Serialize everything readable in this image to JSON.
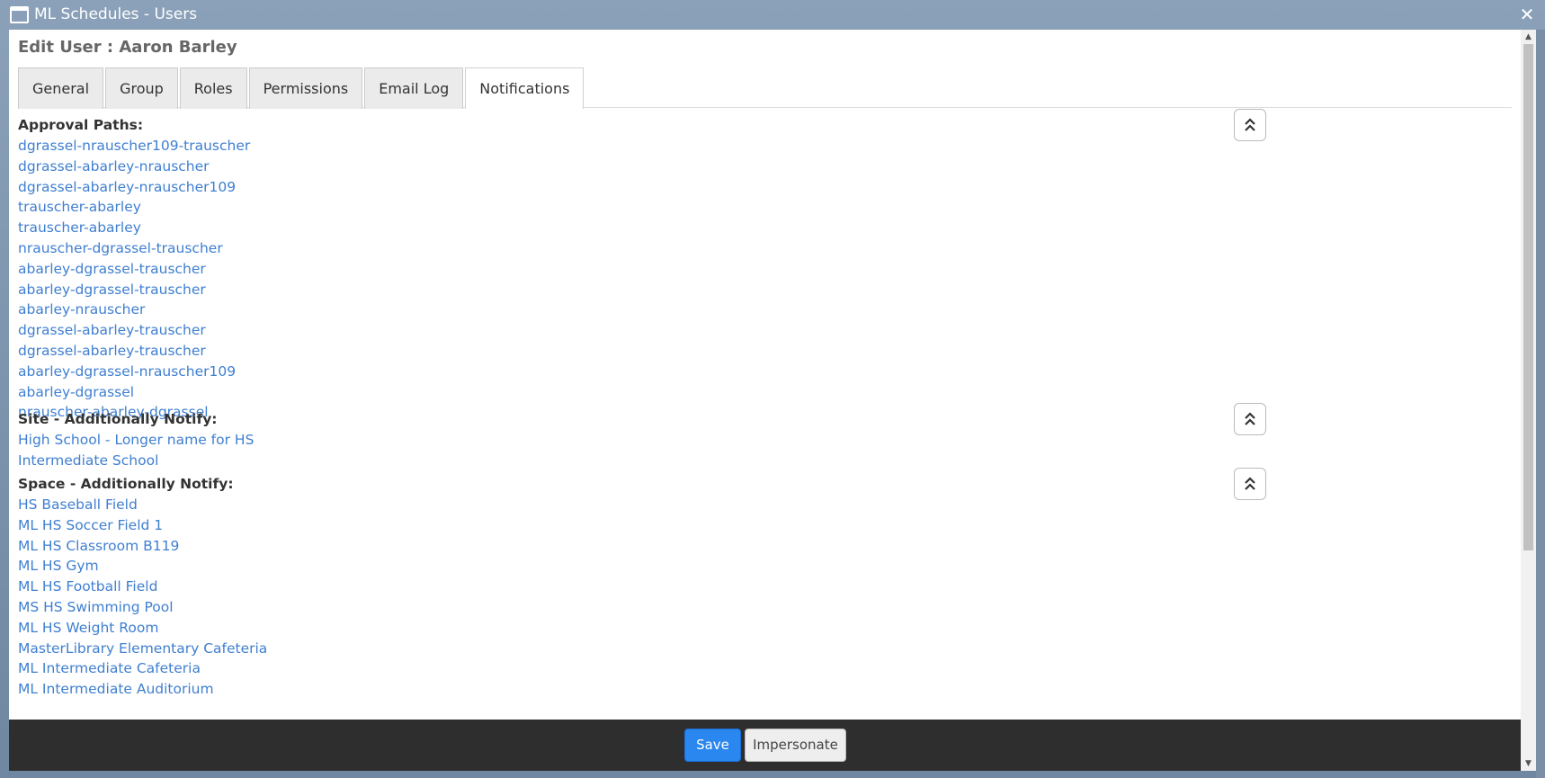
{
  "window": {
    "title": "ML Schedules - Users",
    "icon": "window-icon",
    "close_label": "✕"
  },
  "page": {
    "title": "Edit User : Aaron Barley"
  },
  "tabs": [
    {
      "label": "General",
      "active": false
    },
    {
      "label": "Group",
      "active": false
    },
    {
      "label": "Roles",
      "active": false
    },
    {
      "label": "Permissions",
      "active": false
    },
    {
      "label": "Email Log",
      "active": false
    },
    {
      "label": "Notifications",
      "active": true
    }
  ],
  "sections": {
    "approval": {
      "heading": "Approval Paths:",
      "items": [
        "dgrassel-nrauscher109-trauscher",
        "dgrassel-abarley-nrauscher",
        "dgrassel-abarley-nrauscher109",
        "trauscher-abarley",
        "trauscher-abarley",
        "nrauscher-dgrassel-trauscher",
        "abarley-dgrassel-trauscher",
        "abarley-dgrassel-trauscher",
        "abarley-nrauscher",
        "dgrassel-abarley-trauscher",
        "dgrassel-abarley-trauscher",
        "abarley-dgrassel-nrauscher109",
        "abarley-dgrassel",
        "nrauscher-abarley-dgrassel"
      ]
    },
    "site": {
      "heading": "Site - Additionally Notify:",
      "items": [
        "High School - Longer name for HS",
        "Intermediate School"
      ]
    },
    "space": {
      "heading": "Space - Additionally Notify:",
      "items": [
        "HS Baseball Field",
        "ML HS Soccer Field 1",
        "ML HS Classroom B119",
        "ML HS Gym",
        "ML HS Football Field",
        "MS HS Swimming Pool",
        "ML HS Weight Room",
        "MasterLibrary Elementary Cafeteria",
        "ML Intermediate Cafeteria",
        "ML Intermediate Auditorium"
      ]
    }
  },
  "footer": {
    "save_label": "Save",
    "impersonate_label": "Impersonate"
  },
  "colors": {
    "link": "#3f7fd1",
    "primary_button": "#2a87f0",
    "footer_bg": "#2e2e2e",
    "titlebar": "#7a8fa6"
  }
}
